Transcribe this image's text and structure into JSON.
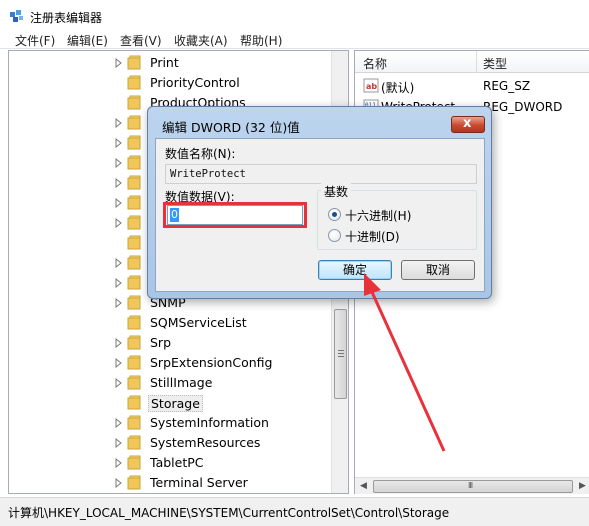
{
  "window": {
    "title": "注册表编辑器",
    "app_icon": "registry-editor-icon"
  },
  "menu": [
    "文件(F)",
    "编辑(E)",
    "查看(V)",
    "收藏夹(A)",
    "帮助(H)"
  ],
  "tree": {
    "items": [
      {
        "label": "Print",
        "expandable": true
      },
      {
        "label": "PriorityControl",
        "expandable": false
      },
      {
        "label": "ProductOptions",
        "expandable": false
      },
      {
        "label": "",
        "expandable": true
      },
      {
        "label": "",
        "expandable": true
      },
      {
        "label": "",
        "expandable": true
      },
      {
        "label": "",
        "expandable": true
      },
      {
        "label": "",
        "expandable": true
      },
      {
        "label": "",
        "expandable": true
      },
      {
        "label": "",
        "expandable": false
      },
      {
        "label": "",
        "expandable": true
      },
      {
        "label": "",
        "expandable": true
      },
      {
        "label": "SNMP",
        "expandable": true
      },
      {
        "label": "SQMServiceList",
        "expandable": false
      },
      {
        "label": "Srp",
        "expandable": true
      },
      {
        "label": "SrpExtensionConfig",
        "expandable": true
      },
      {
        "label": "StillImage",
        "expandable": true
      },
      {
        "label": "Storage",
        "expandable": false,
        "selected": true
      },
      {
        "label": "SystemInformation",
        "expandable": true
      },
      {
        "label": "SystemResources",
        "expandable": true
      },
      {
        "label": "TabletPC",
        "expandable": true
      },
      {
        "label": "Terminal Server",
        "expandable": true
      }
    ]
  },
  "list": {
    "columns": [
      "名称",
      "类型"
    ],
    "rows": [
      {
        "name": "(默认)",
        "type": "REG_SZ",
        "icon": "string-value-icon"
      },
      {
        "name": "WriteProtect",
        "type": "REG_DWORD",
        "icon": "binary-value-icon"
      }
    ]
  },
  "status": {
    "path": "计算机\\HKEY_LOCAL_MACHINE\\SYSTEM\\CurrentControlSet\\Control\\Storage"
  },
  "dialog": {
    "title": "编辑 DWORD (32 位)值",
    "value_name_label": "数值名称(N):",
    "value_name": "WriteProtect",
    "value_data_label": "数值数据(V):",
    "value_data": "0",
    "base_label": "基数",
    "radio_hex": "十六进制(H)",
    "radio_dec": "十进制(D)",
    "selected_base": "hex",
    "ok_label": "确定",
    "cancel_label": "取消",
    "close_label": "x"
  },
  "colors": {
    "highlight_box": "#e8323a",
    "annotation_arrow": "#e8323a"
  }
}
